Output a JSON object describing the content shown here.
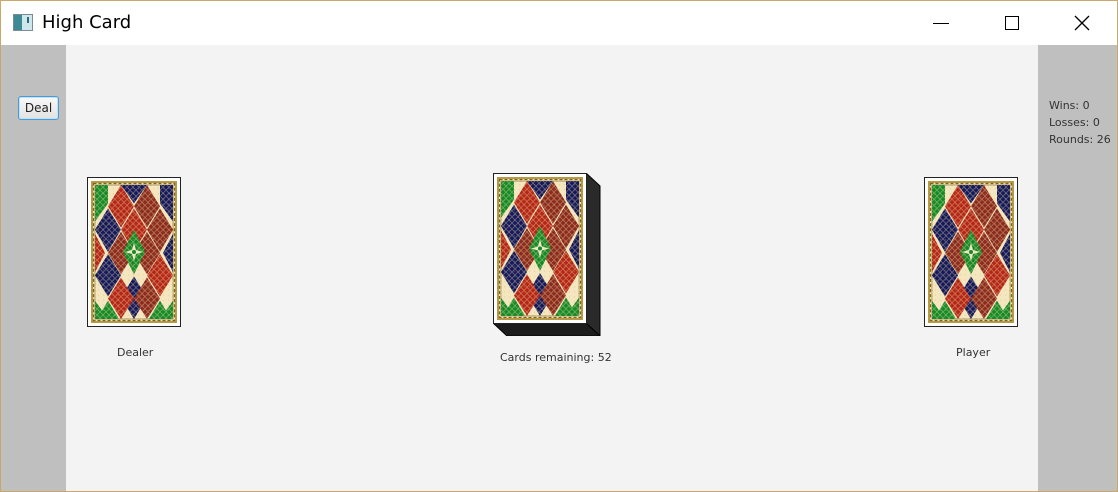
{
  "window": {
    "title": "High Card",
    "controls": {
      "minimize": "minimize-icon",
      "maximize": "maximize-icon",
      "close": "close-icon"
    }
  },
  "toolbar": {
    "deal_label": "Deal"
  },
  "stats": {
    "wins": "Wins: 0",
    "losses": "Losses: 0",
    "rounds": "Rounds: 26"
  },
  "table": {
    "dealer_label": "Dealer",
    "deck_label": "Cards remaining: 52",
    "player_label": "Player"
  },
  "colors": {
    "side_panel": "#bfbfbf",
    "table_bg": "#f3f3f3",
    "card_red": "#b3261a",
    "card_green": "#148a2a",
    "card_navy": "#14195e",
    "card_cream": "#f3e6c4",
    "card_border_gold": "#b89a44",
    "button_focus": "#4a9ad6"
  }
}
